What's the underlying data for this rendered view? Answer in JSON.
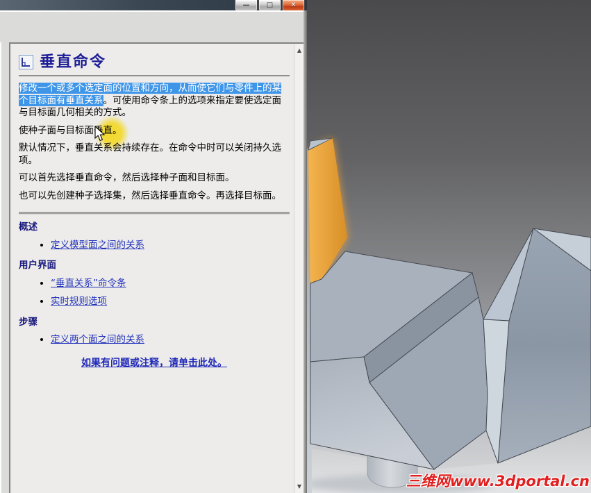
{
  "window": {
    "controls": {
      "minimize": "—",
      "maximize": "□",
      "close": "✕"
    },
    "scroll": {
      "up": "▲",
      "down": "▼"
    }
  },
  "help": {
    "title": "垂直命令",
    "paragraphs": {
      "p1_selected": "修改一个或多个选定面的位置和方向，从而使它们与零件上的某个目标面有垂直关系",
      "p1_rest": "。可使用命令条上的选项来指定要使选定面与目标面几何相关的方式。",
      "p2": "使种子面与目标面垂直。",
      "p3": "默认情况下，垂直关系会持续存在。在命令中时可以关闭持久选项。",
      "p4": "可以首先选择垂直命令，然后选择种子面和目标面。",
      "p5": "也可以先创建种子选择集，然后选择垂直命令。再选择目标面。"
    },
    "sections": [
      {
        "heading": "概述",
        "links": [
          "定义模型面之间的关系"
        ]
      },
      {
        "heading": "用户界面",
        "links": [
          "“垂直关系”命令条",
          "实时规则选项"
        ]
      },
      {
        "heading": "步骤",
        "links": [
          "定义两个面之间的关系"
        ]
      }
    ],
    "feedback_link": "如果有问题或注释，请单击此处。"
  },
  "viewport": {
    "watermark": "三维网www.3dportal.cn"
  },
  "colors": {
    "selection": "#3f96e8",
    "link": "#2233bb",
    "heading": "#1a1a7e",
    "highlight": "#f3d828",
    "target_face_orange": "#e8a33c",
    "watermark_red": "#e02020",
    "titlebar": "#3b4854"
  }
}
